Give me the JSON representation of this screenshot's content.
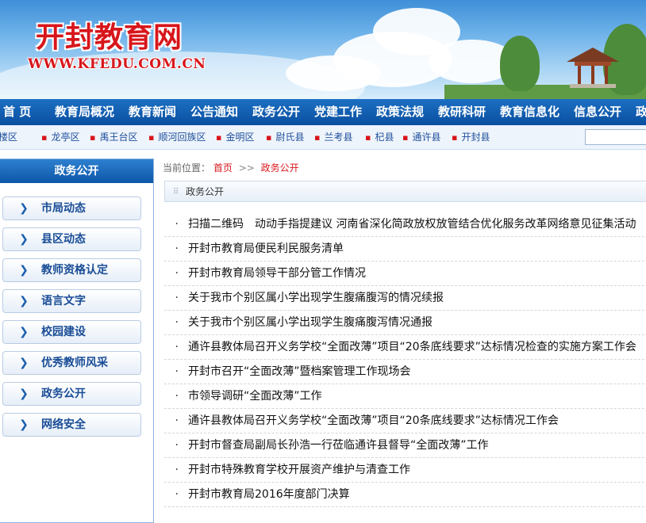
{
  "site": {
    "title": "开封教育网",
    "url": "WWW.KFEDU.COM.CN"
  },
  "main_nav": [
    "首  页",
    "教育局概况",
    "教育新闻",
    "公告通知",
    "政务公开",
    "党建工作",
    "政策法规",
    "教研科研",
    "教育信息化",
    "信息公开",
    "政"
  ],
  "sub_nav": [
    "鼓楼区",
    "龙亭区",
    "禹王台区",
    "顺河回族区",
    "金明区",
    "尉氏县",
    "兰考县",
    "杞县",
    "通许县",
    "开封县"
  ],
  "sidebar": {
    "title": "政务公开",
    "items": [
      "市局动态",
      "县区动态",
      "教师资格认定",
      "语言文字",
      "校园建设",
      "优秀教师风采",
      "政务公开",
      "网络安全"
    ]
  },
  "breadcrumb": {
    "prefix": "当前位置：",
    "home": "首页",
    "separator": ">>",
    "current": "政务公开"
  },
  "section_title": "政务公开",
  "news": [
    "扫描二维码　动动手指提建议 河南省深化简政放权放管结合优化服务改革网络意见征集活动",
    "开封市教育局便民利民服务清单",
    "开封市教育局领导干部分管工作情况",
    "关于我市个别区属小学出现学生腹痛腹泻的情况续报",
    "关于我市个别区属小学出现学生腹痛腹泻情况通报",
    "通许县教体局召开义务学校“全面改薄”项目“20条底线要求”达标情况检查的实施方案工作会",
    "开封市召开“全面改薄”暨档案管理工作现场会",
    "市领导调研“全面改薄”工作",
    "通许县教体局召开义务学校“全面改薄”项目“20条底线要求”达标情况工作会",
    "开封市督查局副局长孙浩一行莅临通许县督导“全面改薄”工作",
    "开封市特殊教育学校开展资产维护与清查工作",
    "开封市教育局2016年度部门决算"
  ],
  "colors": {
    "nav_blue": "#0a4fa0",
    "brand_red": "#d7161b",
    "link_blue": "#1e4f9c"
  }
}
